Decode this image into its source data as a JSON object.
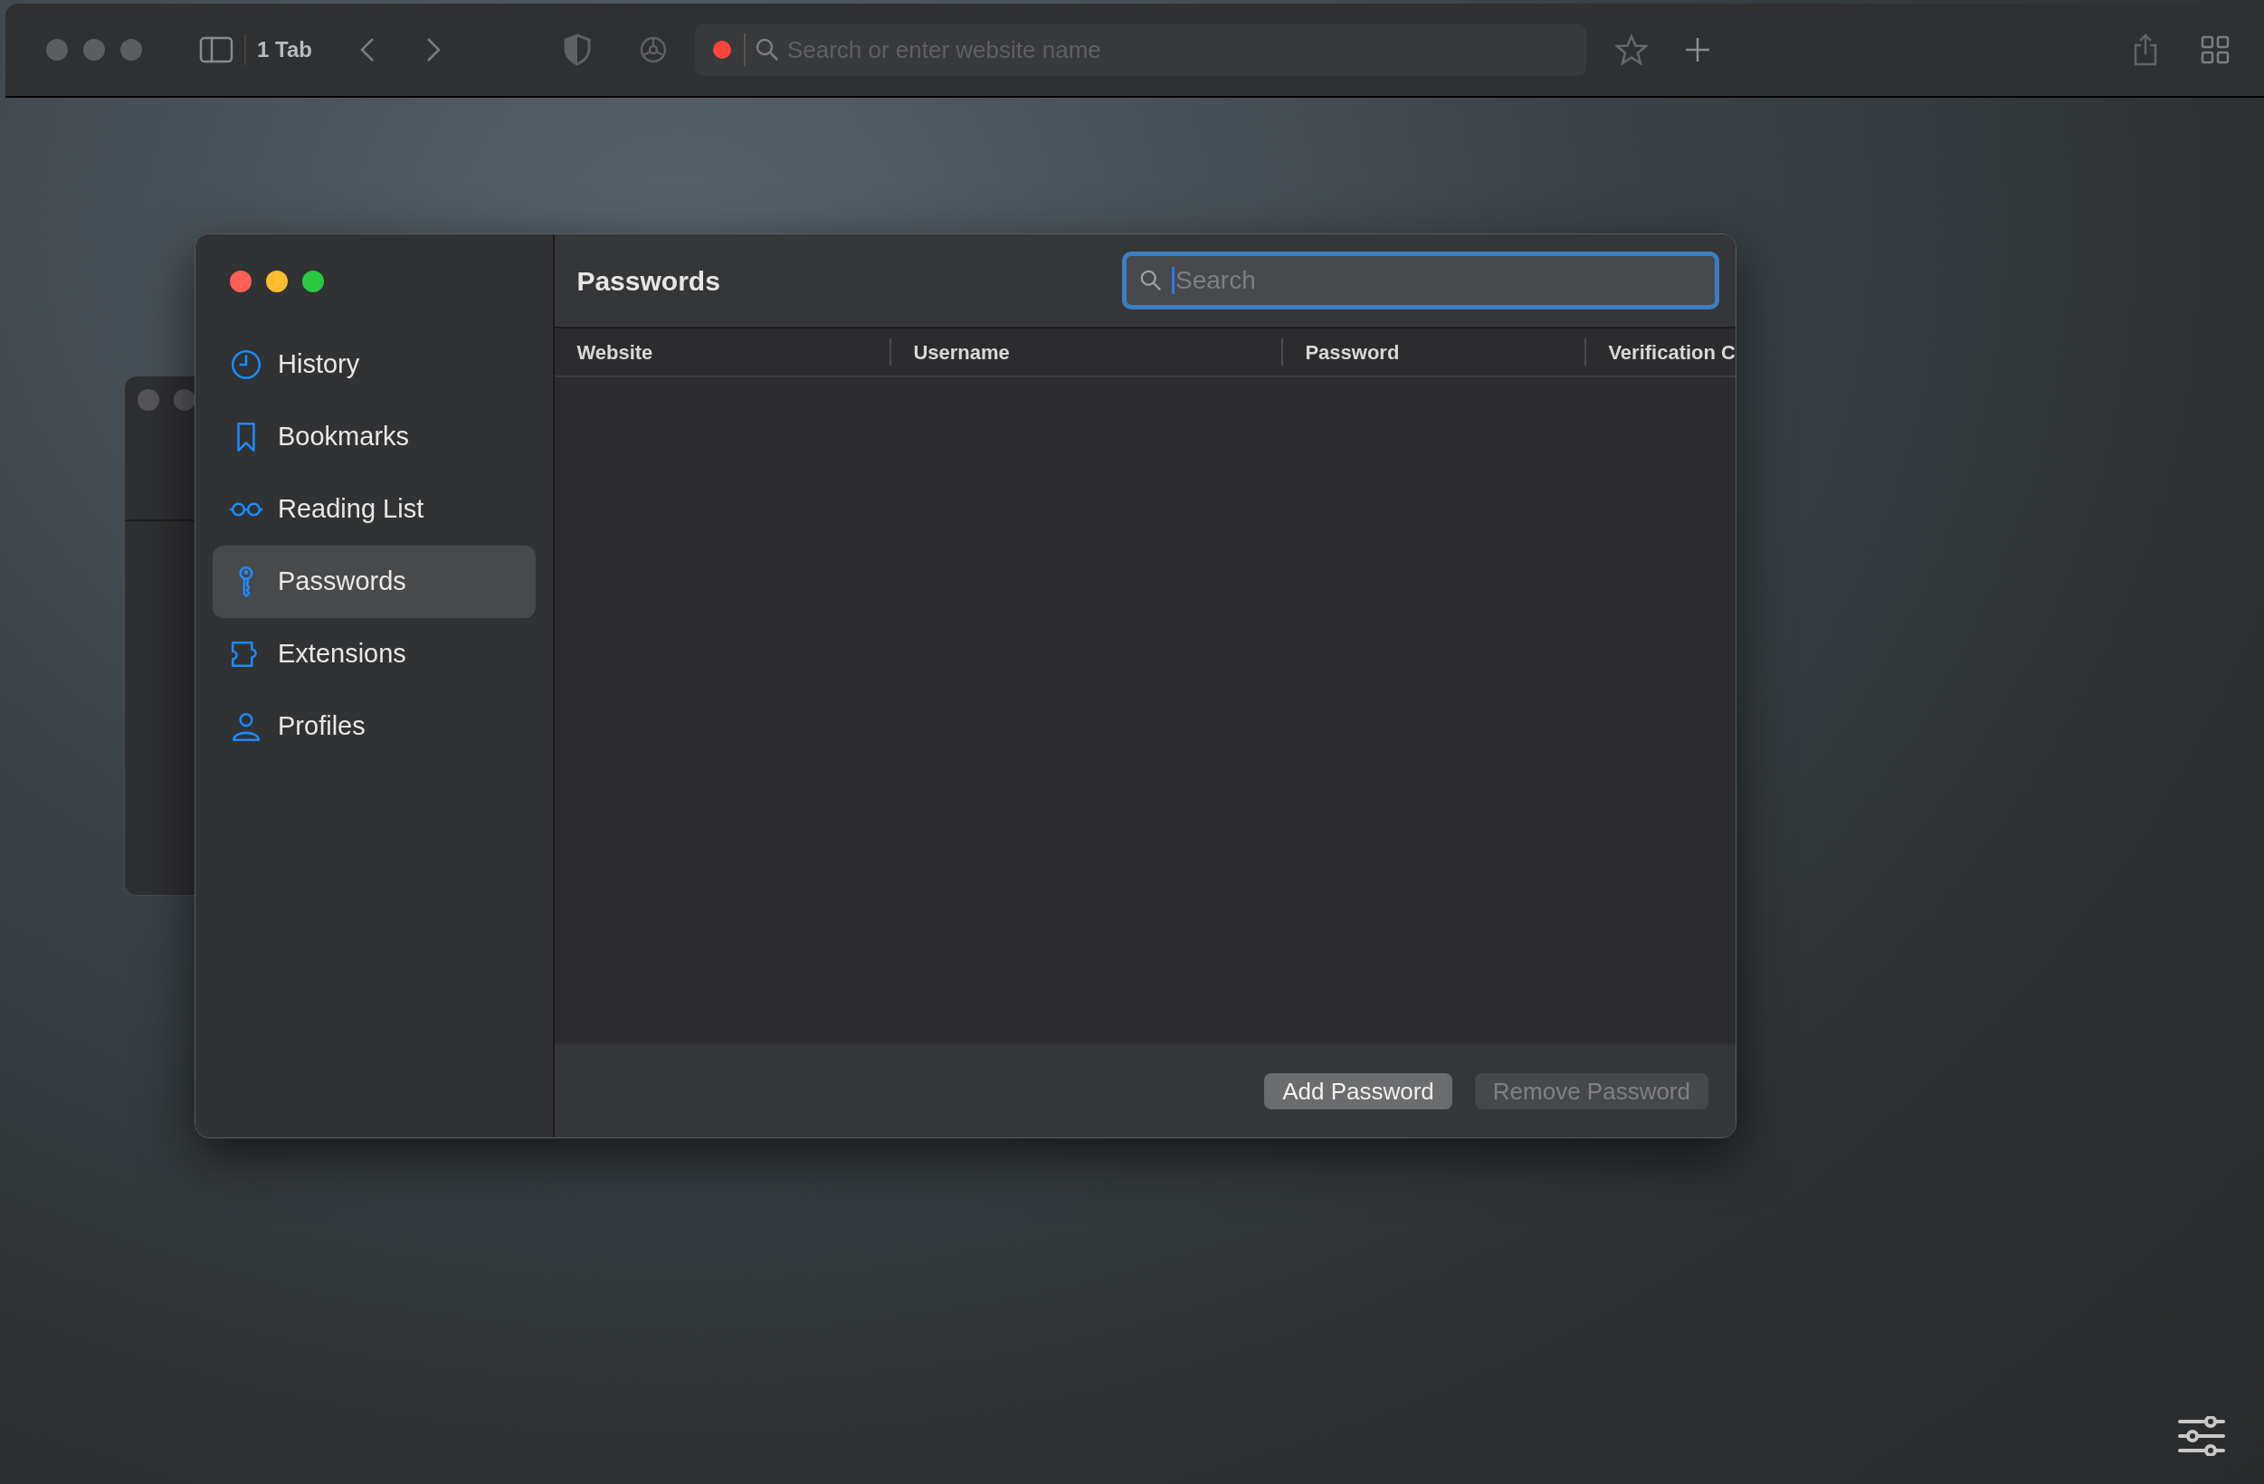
{
  "browser_toolbar": {
    "tab_count": "1 Tab",
    "address_bar": {
      "placeholder": "Search or enter website name",
      "recording": true
    }
  },
  "settings_window": {
    "title": "Passwords",
    "sidebar": {
      "items": [
        {
          "label": "History",
          "kind": "clock",
          "selected": false
        },
        {
          "label": "Bookmarks",
          "kind": "bookmark",
          "selected": false
        },
        {
          "label": "Reading List",
          "kind": "glasses",
          "selected": false
        },
        {
          "label": "Passwords",
          "kind": "key",
          "selected": true
        },
        {
          "label": "Extensions",
          "kind": "puzzle",
          "selected": false
        },
        {
          "label": "Profiles",
          "kind": "person",
          "selected": false
        }
      ]
    },
    "search": {
      "placeholder": "Search",
      "focused": true
    },
    "table": {
      "columns": [
        "Website",
        "Username",
        "Password",
        "Verification C"
      ]
    },
    "buttons": [
      {
        "label": "Add Password",
        "disabled": false
      },
      {
        "label": "Remove Password",
        "disabled": true
      }
    ]
  }
}
